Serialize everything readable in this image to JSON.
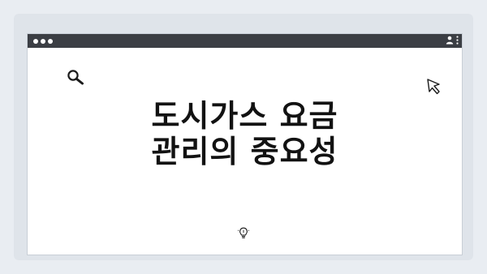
{
  "page": {
    "headline_line1": "도시가스 요금",
    "headline_line2": "관리의 중요성"
  },
  "icons": {
    "frame_dots": "three-dots",
    "window_controls": "traffic-dots",
    "profile": "user-icon",
    "menu": "kebab-icon",
    "search": "search-icon",
    "cursor": "cursor-icon",
    "idea": "lightbulb-icon"
  },
  "colors": {
    "background": "#e9edf2",
    "titlebar": "#3b3e44",
    "text": "#121212"
  }
}
